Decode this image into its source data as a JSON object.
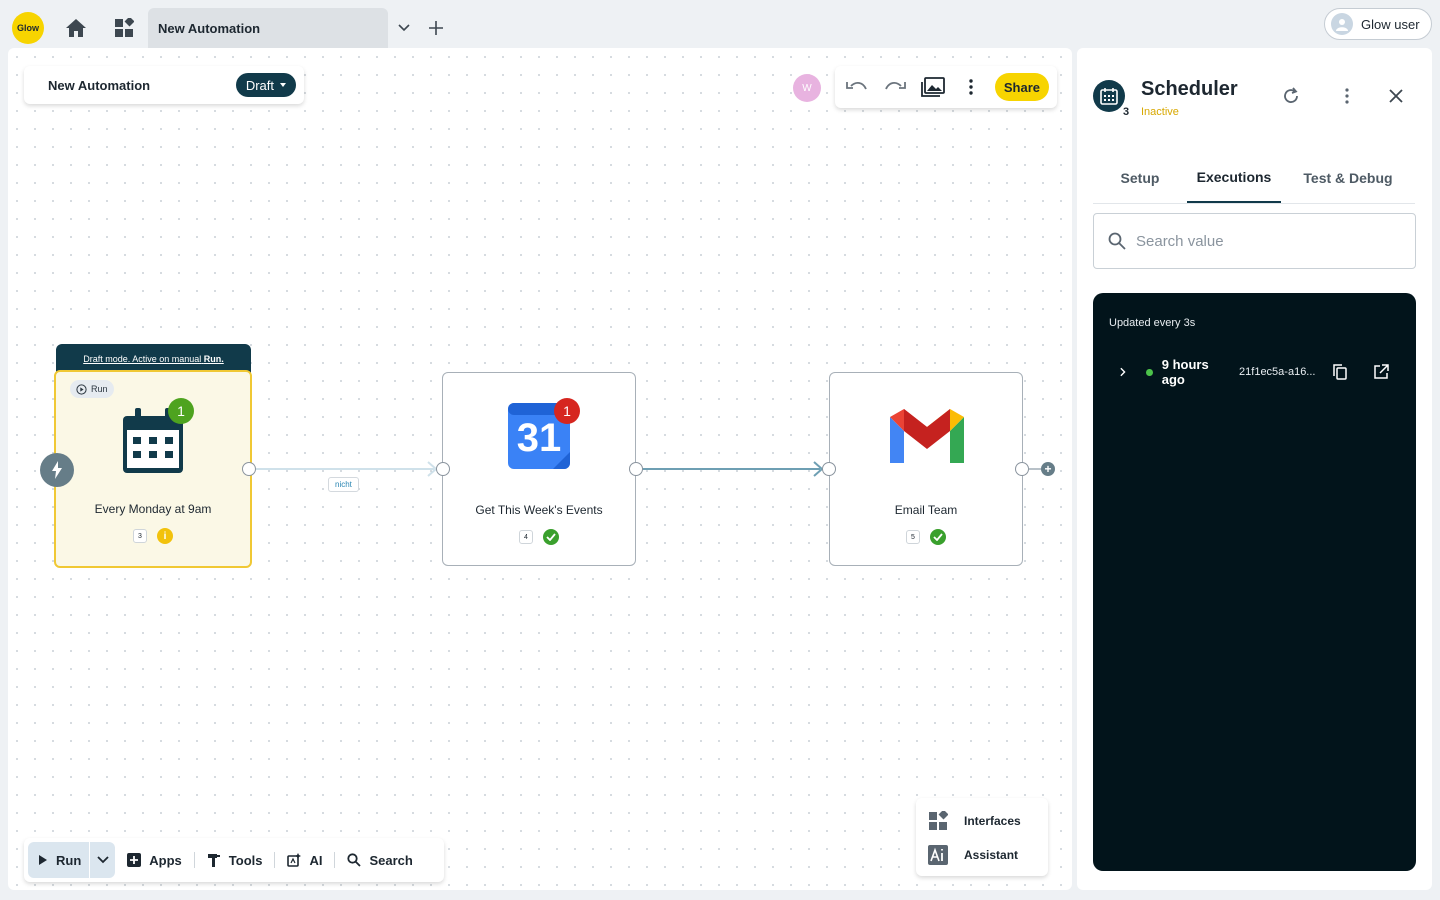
{
  "topbar": {
    "logo_text": "Glow",
    "tab_title": "New Automation",
    "user_name": "Glow user"
  },
  "canvas": {
    "automation_title": "New Automation",
    "status_pill": "Draft",
    "collaborator_initial": "W",
    "share_label": "Share",
    "draft_banner_text": "Draft mode. Active on manual",
    "draft_banner_link": "Run.",
    "run_chip_label": "Run",
    "edge_label": "nicht",
    "nodes": [
      {
        "label": "Every Monday at 9am",
        "step": "3",
        "badge": "1",
        "status": "info"
      },
      {
        "label": "Get This Week's Events",
        "step": "4",
        "badge": "1",
        "status": "success",
        "icon_text": "31"
      },
      {
        "label": "Email Team",
        "step": "5",
        "status": "success"
      }
    ]
  },
  "bottom_bar": {
    "run_label": "Run",
    "apps_label": "Apps",
    "tools_label": "Tools",
    "ai_label": "AI",
    "search_label": "Search"
  },
  "side_tools": {
    "interfaces_label": "Interfaces",
    "assistant_label": "Assistant"
  },
  "panel": {
    "title": "Scheduler",
    "step_number": "3",
    "status": "Inactive",
    "tabs": [
      {
        "label": "Setup",
        "active": false
      },
      {
        "label": "Executions",
        "active": true
      },
      {
        "label": "Test & Debug",
        "active": false
      }
    ],
    "search_placeholder": "Search value",
    "updated_text": "Updated every 3s",
    "executions": [
      {
        "time": "9 hours ago",
        "id": "21f1ec5a-a16...",
        "status_color": "#4cc24a"
      }
    ]
  },
  "colors": {
    "brand_yellow": "#f7d400",
    "dark_teal": "#113a4a",
    "success_green": "#3aa02d",
    "badge_green": "#4ea31f",
    "badge_red": "#d6261f",
    "inactive_amber": "#d8a800"
  }
}
